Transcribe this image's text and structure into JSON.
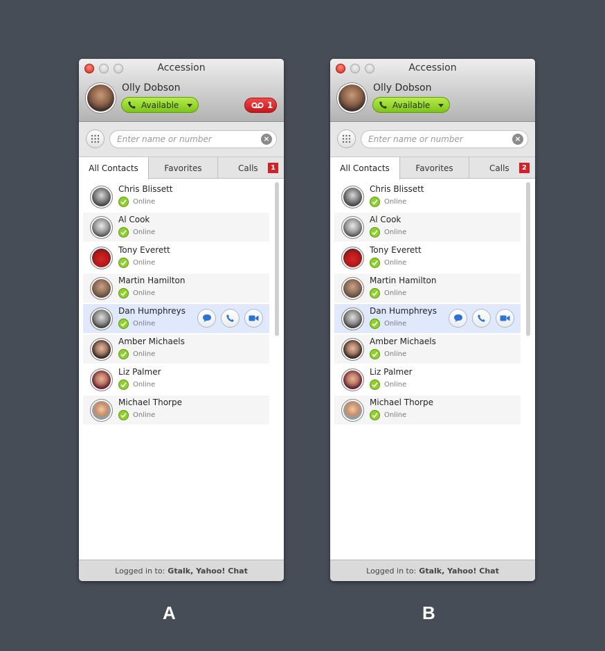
{
  "windows": [
    {
      "caption": "A",
      "title": "Accession",
      "user": {
        "name": "Olly Dobson",
        "status": "Available"
      },
      "voicemail_count": "1",
      "search": {
        "placeholder": "Enter name or number"
      },
      "tabs": [
        {
          "label": "All Contacts"
        },
        {
          "label": "Favorites"
        },
        {
          "label": "Calls",
          "badge": "1"
        }
      ],
      "contacts": [
        {
          "name": "Chris Blissett",
          "status": "Online"
        },
        {
          "name": "Al Cook",
          "status": "Online"
        },
        {
          "name": "Tony Everett",
          "status": "Online"
        },
        {
          "name": "Martin Hamilton",
          "status": "Online"
        },
        {
          "name": "Dan Humphreys",
          "status": "Online"
        },
        {
          "name": "Amber Michaels",
          "status": "Online"
        },
        {
          "name": "Liz Palmer",
          "status": "Online"
        },
        {
          "name": "Michael Thorpe",
          "status": "Online"
        }
      ],
      "footer": {
        "prefix": "Logged in to:",
        "accounts": "Gtalk, Yahoo! Chat"
      }
    },
    {
      "caption": "B",
      "title": "Accession",
      "user": {
        "name": "Olly Dobson",
        "status": "Available"
      },
      "search": {
        "placeholder": "Enter name or number"
      },
      "tabs": [
        {
          "label": "All Contacts"
        },
        {
          "label": "Favorites"
        },
        {
          "label": "Calls",
          "badge": "2"
        }
      ],
      "contacts": [
        {
          "name": "Chris Blissett",
          "status": "Online"
        },
        {
          "name": "Al Cook",
          "status": "Online"
        },
        {
          "name": "Tony Everett",
          "status": "Online"
        },
        {
          "name": "Martin Hamilton",
          "status": "Online"
        },
        {
          "name": "Dan Humphreys",
          "status": "Online"
        },
        {
          "name": "Amber Michaels",
          "status": "Online"
        },
        {
          "name": "Liz Palmer",
          "status": "Online"
        },
        {
          "name": "Michael Thorpe",
          "status": "Online"
        }
      ],
      "footer": {
        "prefix": "Logged in to:",
        "accounts": "Gtalk, Yahoo! Chat"
      }
    }
  ],
  "icons": {
    "dialpad": "dialpad-icon",
    "clear": "clear-icon",
    "status_ok": "checkmark-icon",
    "chat": "chat-icon",
    "call": "phone-icon",
    "video": "video-icon",
    "voicemail": "voicemail-icon"
  },
  "colors": {
    "available_green": "#8fd12a",
    "badge_red": "#d32027",
    "selected_row": "#dfe9fb",
    "action_blue": "#2d73d6",
    "background": "#474d57"
  }
}
